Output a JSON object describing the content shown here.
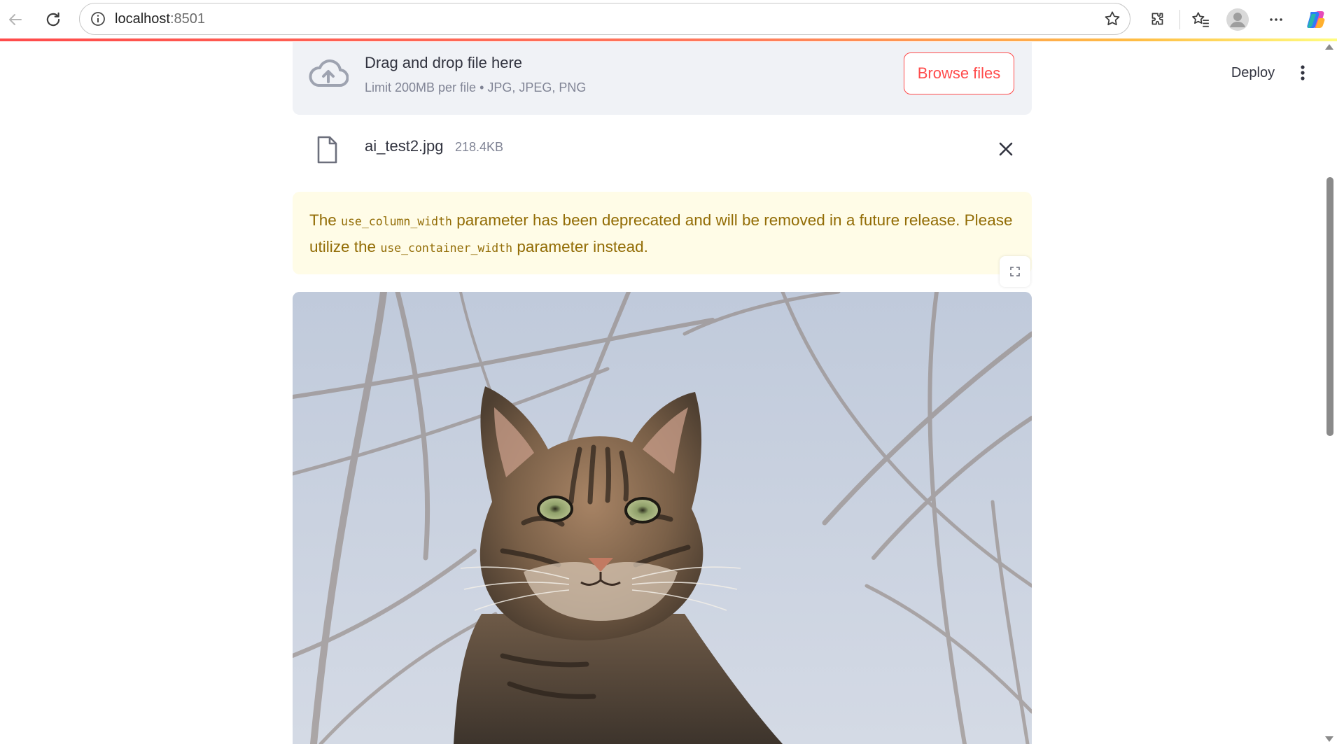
{
  "browser": {
    "url_host": "localhost",
    "url_port": ":8501"
  },
  "header": {
    "deploy_label": "Deploy"
  },
  "uploader": {
    "title": "Drag and drop file here",
    "limit": "Limit 200MB per file • JPG, JPEG, PNG",
    "browse_label": "Browse files"
  },
  "file": {
    "name": "ai_test2.jpg",
    "size": "218.4KB"
  },
  "warning": {
    "part1": "The ",
    "code1": "use_column_width",
    "part2": " parameter has been deprecated and will be removed in a future release. Please utilize the ",
    "code2": "use_container_width",
    "part3": " parameter instead."
  },
  "colors": {
    "accent": "#ff4b4b",
    "warning_text": "#926c05",
    "warning_bg": "#fffce7",
    "dropzone_bg": "#f0f2f6"
  }
}
